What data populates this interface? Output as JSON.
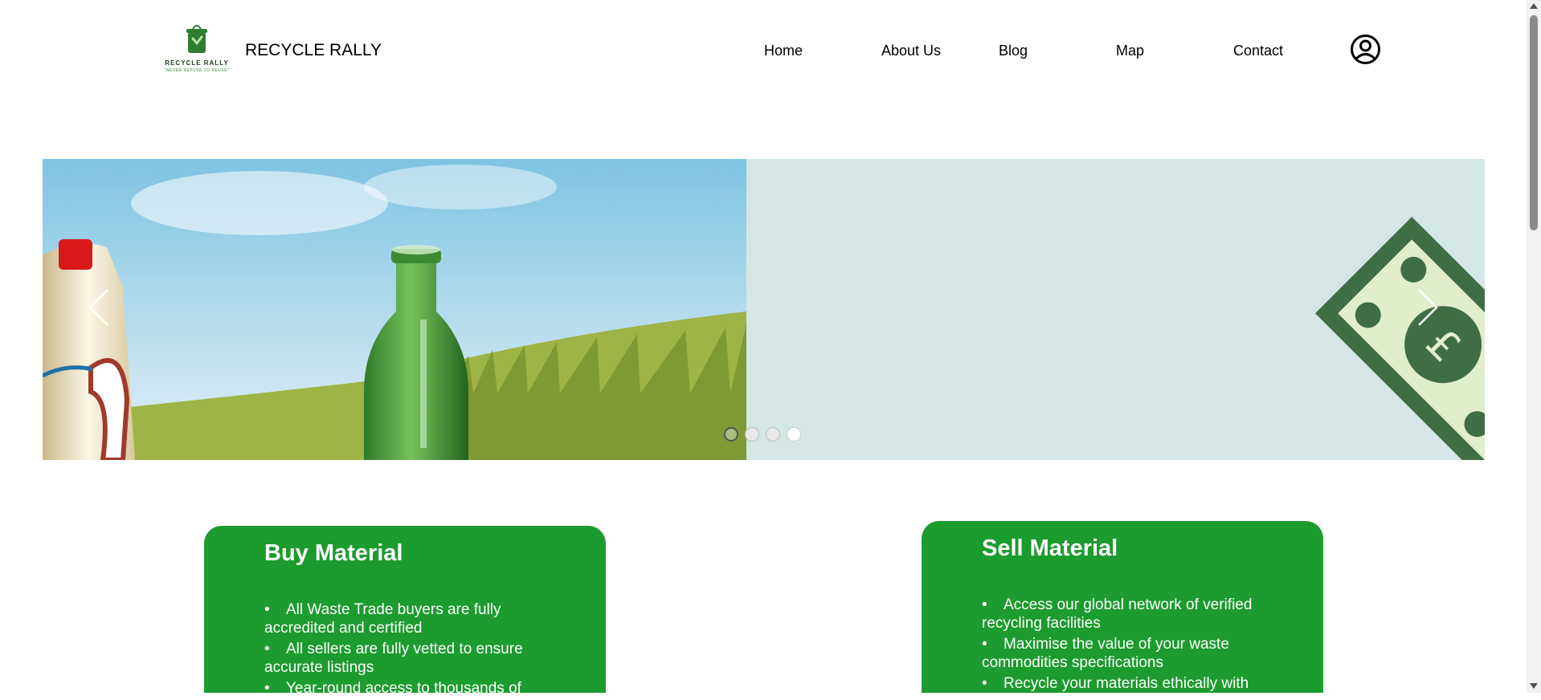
{
  "header": {
    "logo": {
      "icon": "recycle-bin-logo",
      "name": "RECYCLE RALLY",
      "tagline": "\"NEVER REFUSE TO REUSE\""
    },
    "brand": "RECYCLE RALLY",
    "nav": [
      {
        "label": "Home"
      },
      {
        "label": "About Us"
      },
      {
        "label": "Blog"
      },
      {
        "label": "Map"
      },
      {
        "label": "Contact"
      }
    ],
    "account_icon": "user-account-icon"
  },
  "slider": {
    "prev_icon": "chevron-left-icon",
    "next_icon": "chevron-right-icon",
    "slide_count": 4,
    "active_index": 4
  },
  "cards": {
    "buy": {
      "title": "Buy Material",
      "items": [
        "All Waste Trade buyers are fully accredited and certified",
        "All sellers are fully vetted to ensure accurate listings",
        "Year-round access to thousands of"
      ]
    },
    "sell": {
      "title": "Sell Material",
      "items": [
        "Access our global network of verified recycling facilities",
        "Maximise the value of your waste commodities specifications",
        "Recycle your materials ethically with"
      ]
    }
  },
  "colors": {
    "card_green": "#1c9b2e",
    "logo_green": "#2e7d32",
    "slide_bg": "#d4e7e6",
    "note_green": "#3f6e45"
  }
}
